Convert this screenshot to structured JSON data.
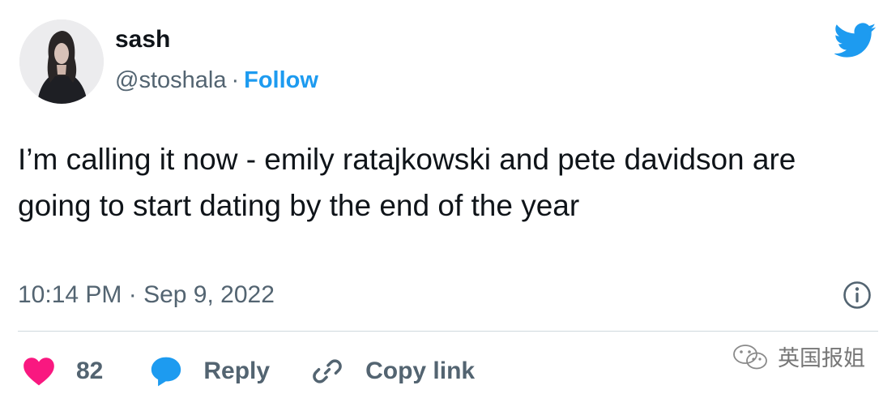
{
  "author": {
    "display_name": "sash",
    "handle": "@stoshala",
    "separator": "·",
    "follow_label": "Follow"
  },
  "tweet": {
    "text": "I’m calling it now - emily ratajkowski and pete davidson are going to start dating by the end of the year",
    "timestamp": "10:14 PM · Sep 9, 2022"
  },
  "actions": {
    "like_count": "82",
    "reply_label": "Reply",
    "copy_link_label": "Copy link"
  },
  "watermark": {
    "text": "英国报姐"
  },
  "icons": {
    "logo": "twitter-bird-icon",
    "info": "info-icon",
    "like": "heart-icon",
    "reply": "speech-bubble-icon",
    "copy": "link-icon"
  },
  "colors": {
    "accent": "#1d9bf0",
    "like": "#f91880",
    "text_primary": "#0f1419",
    "text_secondary": "#536471",
    "divider": "#cfd9de"
  }
}
